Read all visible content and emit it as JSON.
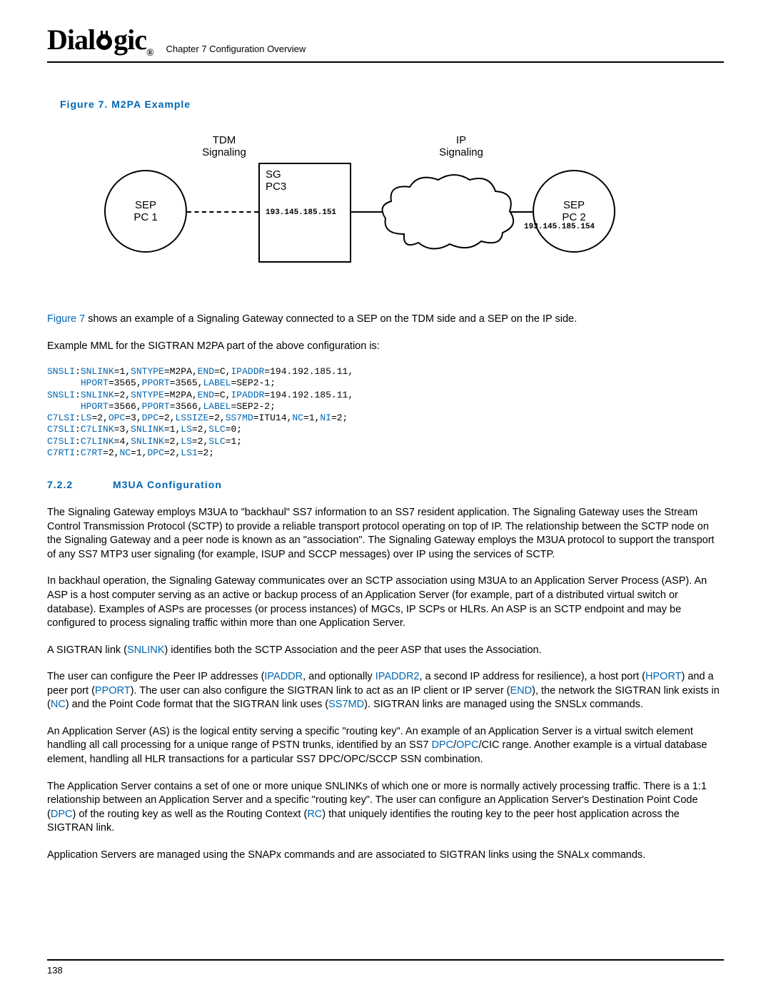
{
  "header": {
    "logo_left": "Dial",
    "logo_right": "gic",
    "chapter": "Chapter 7 Configuration Overview"
  },
  "figure": {
    "caption": "Figure 7. M2PA Example",
    "tdm_label1": "TDM",
    "tdm_label2": "Signaling",
    "ip_label1": "IP",
    "ip_label2": "Signaling",
    "sep1_l1": "SEP",
    "sep1_l2": "PC 1",
    "sg_l1": "SG",
    "sg_l2": "PC3",
    "sg_ip": "193.145.185.151",
    "sep2_l1": "SEP",
    "sep2_l2": "PC 2",
    "sep2_ip": "193.145.185.154"
  },
  "para1_pre": "Figure 7",
  "para1_post": " shows an example of a Signaling Gateway connected to a SEP on the TDM side and a SEP on the IP side.",
  "para2": "Example MML for the SIGTRAN M2PA part of the above configuration is:",
  "mml": {
    "l1a": "SNSLI",
    "l1b": ":",
    "l1c": "SNLINK",
    "l1d": "=1,",
    "l1e": "SNTYPE",
    "l1f": "=M2PA,",
    "l1g": "END",
    "l1h": "=C,",
    "l1i": "IPADDR",
    "l1j": "=194.192.185.11,",
    "l2a": "      ",
    "l2b": "HPORT",
    "l2c": "=3565,",
    "l2d": "PPORT",
    "l2e": "=3565,",
    "l2f": "LABEL",
    "l2g": "=SEP2-1;",
    "l3a": "SNSLI",
    "l3b": ":",
    "l3c": "SNLINK",
    "l3d": "=2,",
    "l3e": "SNTYPE",
    "l3f": "=M2PA,",
    "l3g": "END",
    "l3h": "=C,",
    "l3i": "IPADDR",
    "l3j": "=194.192.185.11,",
    "l4a": "      ",
    "l4b": "HPORT",
    "l4c": "=3566,",
    "l4d": "PPORT",
    "l4e": "=3566,",
    "l4f": "LABEL",
    "l4g": "=SEP2-2;",
    "l5a": "C7LSI",
    "l5b": ":",
    "l5c": "LS",
    "l5d": "=2,",
    "l5e": "OPC",
    "l5f": "=3,",
    "l5g": "DPC",
    "l5h": "=2,",
    "l5i": "LSSIZE",
    "l5j": "=2,",
    "l5k": "SS7MD",
    "l5l": "=ITU14,",
    "l5m": "NC",
    "l5n": "=1,",
    "l5o": "NI",
    "l5p": "=2;",
    "l6a": "C7SLI",
    "l6b": ":",
    "l6c": "C7LINK",
    "l6d": "=3,",
    "l6e": "SNLINK",
    "l6f": "=1,",
    "l6g": "LS",
    "l6h": "=2,",
    "l6i": "SLC",
    "l6j": "=0;",
    "l7a": "C7SLI",
    "l7b": ":",
    "l7c": "C7LINK",
    "l7d": "=4,",
    "l7e": "SNLINK",
    "l7f": "=2,",
    "l7g": "LS",
    "l7h": "=2,",
    "l7i": "SLC",
    "l7j": "=1;",
    "l8a": "C7RTI",
    "l8b": ":",
    "l8c": "C7RT",
    "l8d": "=2,",
    "l8e": "NC",
    "l8f": "=1,",
    "l8g": "DPC",
    "l8h": "=2,",
    "l8i": "LS1",
    "l8j": "=2;"
  },
  "section": {
    "num": "7.2.2",
    "title": "M3UA Configuration"
  },
  "p3": "The Signaling Gateway employs M3UA to \"backhaul\" SS7 information to an SS7 resident application. The Signaling Gateway uses the Stream Control Transmission Protocol (SCTP) to provide a reliable transport protocol operating on top of IP. The relationship between the SCTP node on the Signaling Gateway and a peer node is known as an \"association\". The Signaling Gateway employs the M3UA protocol to support the transport of any SS7 MTP3 user signaling (for example, ISUP and SCCP messages) over IP using the services of SCTP.",
  "p4": "In backhaul operation, the Signaling Gateway communicates over an SCTP association using M3UA to an Application Server Process (ASP). An ASP is a host computer serving as an active or backup process of an Application Server (for example, part of a distributed virtual switch or database). Examples of ASPs are processes (or process instances) of MGCs, IP SCPs or HLRs. An ASP is an SCTP endpoint and may be configured to process signaling traffic within more than one Application Server.",
  "p5_a": "A SIGTRAN link (",
  "p5_b": "SNLINK",
  "p5_c": ") identifies both the SCTP Association and the peer ASP that uses the Association.",
  "p6_a": "The user can configure the Peer IP addresses (",
  "p6_b": "IPADDR",
  "p6_c": ", and optionally ",
  "p6_d": "IPADDR2",
  "p6_e": ", a second IP address for resilience), a host port (",
  "p6_f": "HPORT",
  "p6_g": ") and a peer port (",
  "p6_h": "PPORT",
  "p6_i": "). The user can also configure the SIGTRAN link to act as an IP client or IP server (",
  "p6_j": "END",
  "p6_k": "), the network the SIGTRAN link exists in (",
  "p6_l": "NC",
  "p6_m": ") and the Point Code format that the SIGTRAN link uses (",
  "p6_n": "SS7MD",
  "p6_o": "). SIGTRAN links are managed using the SNSLx commands.",
  "p7_a": "An Application Server (AS) is the logical entity serving a specific \"routing key\". An example of an Application Server is a virtual switch element handling all call processing for a unique range of PSTN trunks, identified by an SS7 ",
  "p7_b": "DPC",
  "p7_c": "/",
  "p7_d": "OPC",
  "p7_e": "/CIC range. Another example is a virtual database element, handling all HLR transactions for a particular SS7 DPC/OPC/SCCP SSN combination.",
  "p8_a": "The Application Server contains a set of one or more unique SNLINKs of which one or more is normally actively processing traffic. There is a 1:1 relationship between an Application Server and a specific \"routing key\". The user can configure an Application Server's Destination Point Code (",
  "p8_b": "DPC",
  "p8_c": ") of the routing key as well as the Routing Context (",
  "p8_d": "RC",
  "p8_e": ") that uniquely identifies the routing key to the peer host application across the SIGTRAN link.",
  "p9": "Application Servers are managed using the SNAPx commands and are associated to SIGTRAN links using the SNALx commands.",
  "footer": {
    "page": "138"
  }
}
